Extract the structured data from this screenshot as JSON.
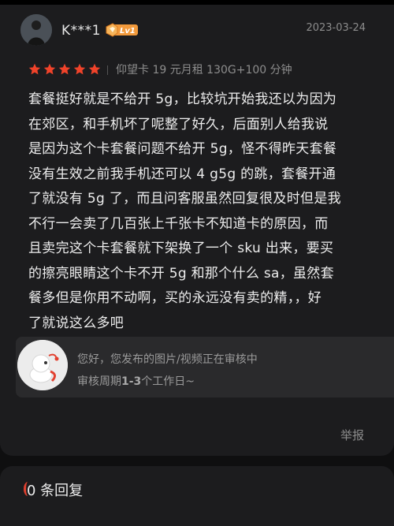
{
  "review": {
    "username": "K***1",
    "level_badge": "Lv1",
    "date": "2023-03-24",
    "rating": 5,
    "product_spec": "仰望卡 19 元月租 130G+100 分钟",
    "body_lines": [
      "套餐挺好就是不给开 5g，比较坑开始我还以为因为",
      "在郊区，和手机坏了呢整了好久，后面别人给我说",
      "是因为这个卡套餐问题不给开 5g，怪不得昨天套餐",
      "没有生效之前我手机还可以 4 g5g 的跳，套餐开通",
      "了就没有 5g 了，而且问客服虽然回复很及时但是我",
      "不行一会卖了几百张上千张卡不知道卡的原因，而",
      "且卖完这个卡套餐就下架换了一个 sku 出来，要买",
      "的擦亮眼睛这个卡不开 5g 和那个什么 sa，虽然套",
      "餐多但是你用不动啊，买的永远没有卖的精，，好",
      "了就说这么多吧"
    ]
  },
  "moderation": {
    "line1": "您好，您发布的图片/视频正在审核中",
    "line2_prefix": "审核周期",
    "line2_bold": "1-3",
    "line2_suffix": "个工作日~"
  },
  "actions": {
    "report_label": "举报"
  },
  "replies": {
    "count": "0",
    "label": " 条回复"
  },
  "colors": {
    "star": "#f0432a",
    "background": "#0f0f10",
    "card": "#1c1c1e",
    "badge": "#f29a3c"
  }
}
